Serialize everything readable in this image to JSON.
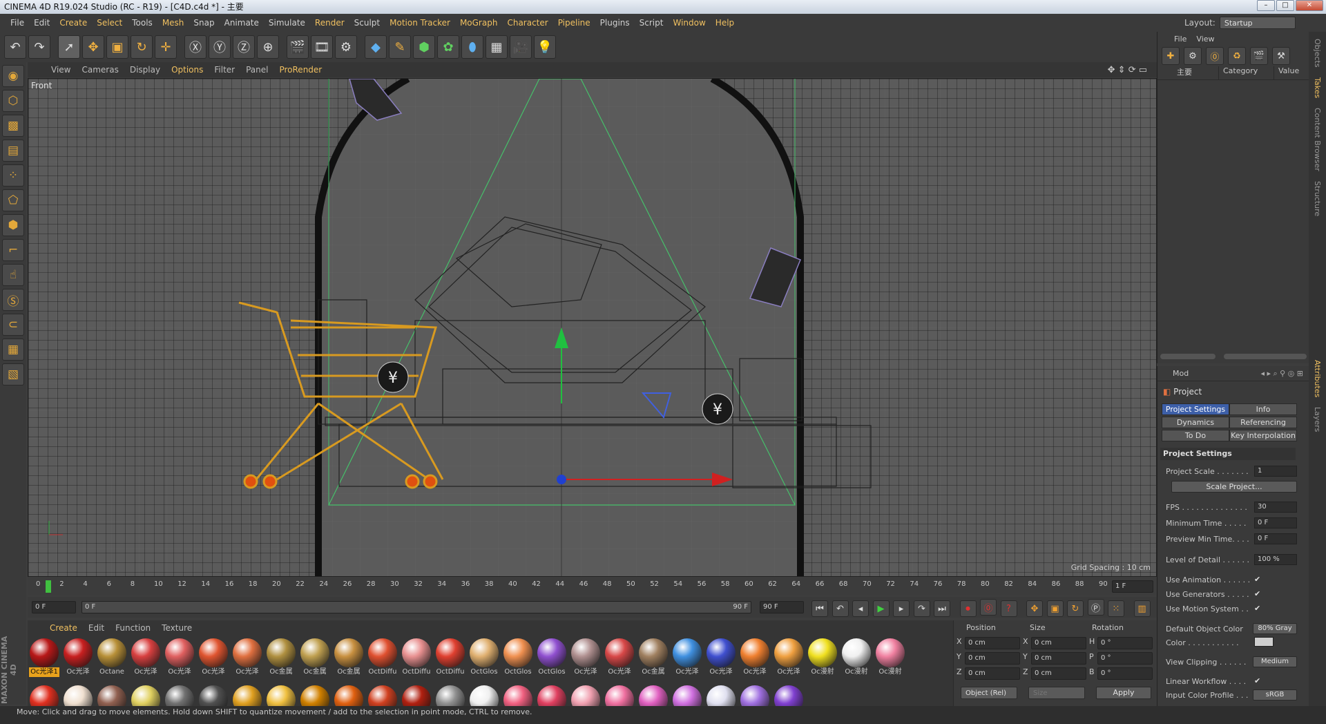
{
  "window": {
    "title": "CINEMA 4D R19.024 Studio (RC - R19) - [C4D.c4d *] - 主要"
  },
  "menus": [
    "File",
    "Edit",
    "Create",
    "Select",
    "Tools",
    "Mesh",
    "Snap",
    "Animate",
    "Simulate",
    "Render",
    "Sculpt",
    "Motion Tracker",
    "MoGraph",
    "Character",
    "Pipeline",
    "Plugins",
    "Script",
    "Window",
    "Help"
  ],
  "layout": {
    "label": "Layout:",
    "value": "Startup"
  },
  "viewport": {
    "menus": [
      "View",
      "Cameras",
      "Display",
      "Options",
      "Filter",
      "Panel",
      "ProRender"
    ],
    "label": "Front",
    "grid_spacing": "Grid Spacing : 10 cm"
  },
  "timeline": {
    "ticks": [
      "0",
      "2",
      "4",
      "6",
      "8",
      "10",
      "12",
      "14",
      "16",
      "18",
      "20",
      "22",
      "24",
      "26",
      "28",
      "30",
      "32",
      "34",
      "36",
      "38",
      "40",
      "42",
      "44",
      "46",
      "48",
      "50",
      "52",
      "54",
      "56",
      "58",
      "60",
      "62",
      "64",
      "66",
      "68",
      "70",
      "72",
      "74",
      "76",
      "78",
      "80",
      "82",
      "84",
      "86",
      "88",
      "90"
    ],
    "current_frame": "1 F",
    "start": "0 F",
    "range_start": "0 F",
    "range_end": "90 F",
    "end": "90 F"
  },
  "materials": {
    "menus": [
      "Create",
      "Edit",
      "Function",
      "Texture"
    ],
    "row1": [
      {
        "name": "Oc光泽1",
        "color": "#b81818",
        "selected": true
      },
      {
        "name": "Oc光泽",
        "color": "#c82020"
      },
      {
        "name": "Octane",
        "color": "#b89038"
      },
      {
        "name": "Oc光泽",
        "color": "#d84040"
      },
      {
        "name": "Oc光泽",
        "color": "#e06060"
      },
      {
        "name": "Oc光泽",
        "color": "#e05530"
      },
      {
        "name": "Oc光泽",
        "color": "#e07040"
      },
      {
        "name": "Oc金属",
        "color": "#b09040"
      },
      {
        "name": "Oc金属",
        "color": "#c0a050"
      },
      {
        "name": "Oc金属",
        "color": "#c89040"
      },
      {
        "name": "OctDiffu",
        "color": "#e05030"
      },
      {
        "name": "OctDiffu",
        "color": "#e89090"
      },
      {
        "name": "OctDiffu",
        "color": "#e04030"
      },
      {
        "name": "OctGlos",
        "color": "#e0b070"
      },
      {
        "name": "OctGlos",
        "color": "#f09050"
      },
      {
        "name": "OctGlos",
        "color": "#9050d0"
      },
      {
        "name": "Oc光泽",
        "color": "#b09090"
      },
      {
        "name": "Oc光泽",
        "color": "#d84848"
      },
      {
        "name": "Oc金属",
        "color": "#a08060"
      },
      {
        "name": "Oc光泽",
        "color": "#4090e0"
      },
      {
        "name": "Oc光泽",
        "color": "#4050d0"
      },
      {
        "name": "Oc光泽",
        "color": "#f08030"
      },
      {
        "name": "Oc光泽",
        "color": "#f0a040"
      },
      {
        "name": "Oc漫射",
        "color": "#f0e020"
      },
      {
        "name": "Oc漫射",
        "color": "#f0f0f0"
      },
      {
        "name": "Oc漫射",
        "color": "#f080a0"
      }
    ],
    "row2": [
      "#e03020",
      "#f0e0d0",
      "#906050",
      "#e0d060",
      "#707070",
      "#505050",
      "#e0a020",
      "#f0c040",
      "#d08000",
      "#e06010",
      "#d04020",
      "#b02010",
      "#909090",
      "#f0f0f0",
      "#f06080",
      "#e04060",
      "#f0a0b0",
      "#f070a0",
      "#e060c0",
      "#d070e0",
      "#e0e0f0",
      "#a070e0",
      "#8040d0"
    ]
  },
  "coords": {
    "headers": [
      "Position",
      "Size",
      "Rotation"
    ],
    "rows": [
      {
        "axis": "X",
        "pos": "0 cm",
        "saxis": "X",
        "size": "0 cm",
        "raxis": "H",
        "rot": "0 °"
      },
      {
        "axis": "Y",
        "pos": "0 cm",
        "saxis": "Y",
        "size": "0 cm",
        "raxis": "P",
        "rot": "0 °"
      },
      {
        "axis": "Z",
        "pos": "0 cm",
        "saxis": "Z",
        "size": "0 cm",
        "raxis": "B",
        "rot": "0 °"
      }
    ],
    "mode": "Object (Rel)",
    "size_mode": "Size",
    "apply": "Apply"
  },
  "objects": {
    "menus": [
      "File",
      "View"
    ],
    "tree_item": "主要",
    "columns": [
      "Category",
      "Value"
    ]
  },
  "attributes": {
    "mode_label": "Mod",
    "section": "Project",
    "tabs": [
      "Project Settings",
      "Info",
      "Dynamics",
      "Referencing",
      "To Do",
      "Key Interpolation"
    ],
    "group": "Project Settings",
    "project_scale_label": "Project Scale . . . . . . .",
    "project_scale": "1",
    "scale_button": "Scale Project...",
    "fps_label": "FPS . . . . . . . . . . . . . .",
    "fps": "30",
    "min_time_label": "Minimum Time . . . . .",
    "min_time": "0 F",
    "preview_min_label": "Preview Min Time. . . .",
    "preview_min": "0 F",
    "lod_label": "Level of Detail . . . . . .",
    "lod": "100 %",
    "use_animation": "Use Animation . . . . . .",
    "use_generators": "Use Generators . . . . .",
    "use_motion": "Use Motion System . .",
    "default_color_label": "Default Object Color",
    "default_color": "80% Gray",
    "color_label": "Color . . . . . . . . . . .",
    "view_clipping_label": "View Clipping . . . . . .",
    "view_clipping": "Medium",
    "linear_label": "Linear Workflow . . . .",
    "profile_label": "Input Color Profile . . .",
    "profile": "sRGB"
  },
  "side_tabs": [
    "Objects",
    "Takes",
    "Content Browser",
    "Structure",
    "Attributes",
    "Layers"
  ],
  "status": "Move: Click and drag to move elements. Hold down SHIFT to quantize movement / add to the selection in point mode, CTRL to remove.",
  "maxon_brand": "MAXON CINEMA 4D"
}
